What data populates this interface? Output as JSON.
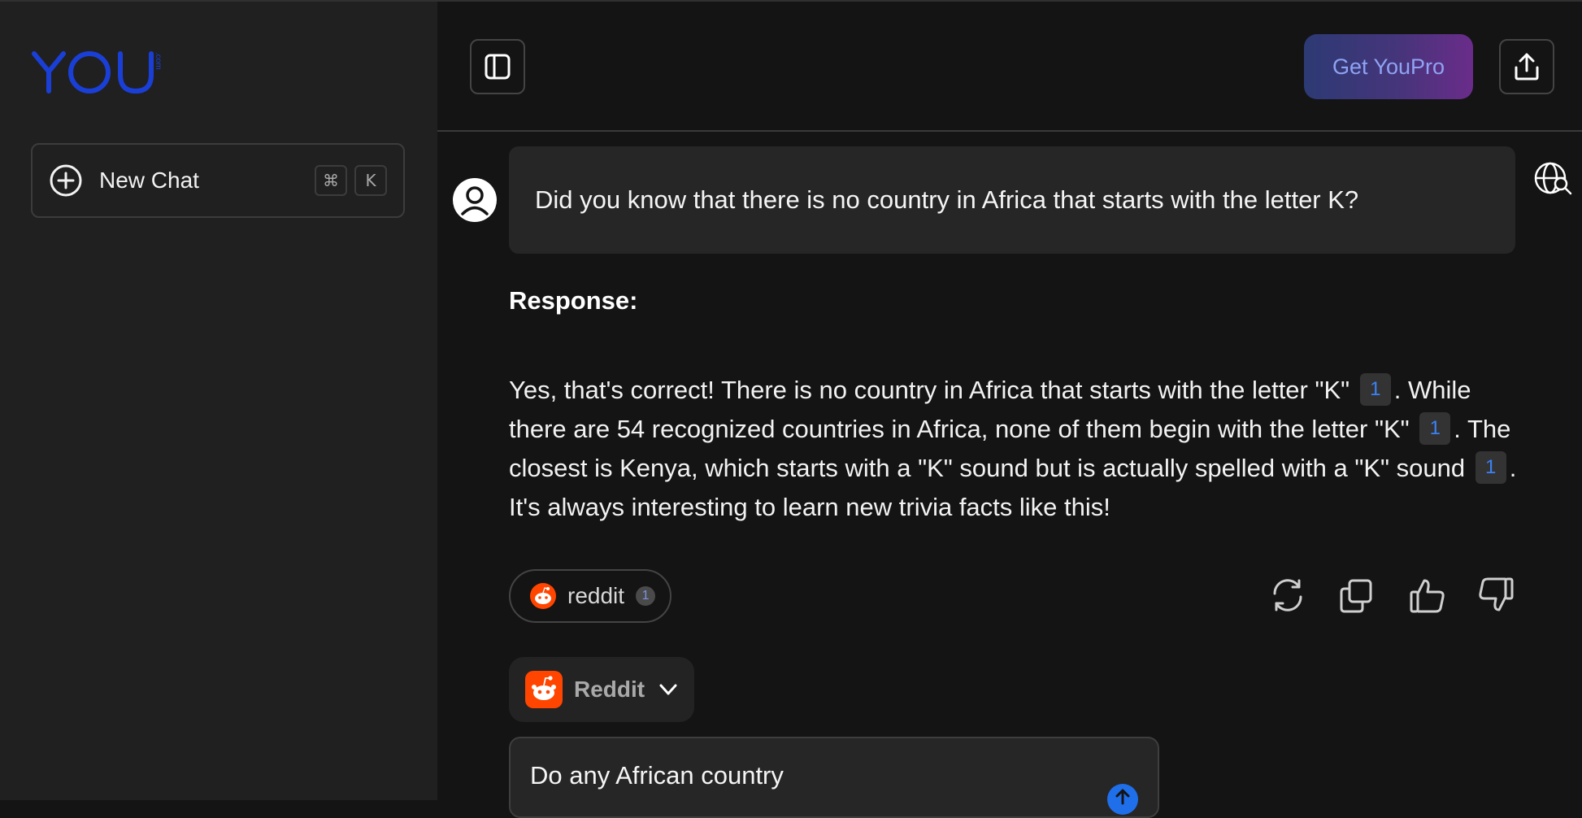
{
  "brand": {
    "logo_text": "YOU",
    "logo_suffix": ".com",
    "accent": "#1a3fd6"
  },
  "sidebar": {
    "new_chat_label": "New Chat",
    "shortcut_keys": [
      "⌘",
      "K"
    ]
  },
  "header": {
    "upgrade_label": "Get YouPro"
  },
  "conversation": {
    "question": "Did you know that there is no country in Africa that starts with the letter K?",
    "response_label": "Response:",
    "answer_parts": {
      "p1": "Yes, that's correct! There is no country in Africa that starts with the letter \"K\"",
      "c1": "1",
      "p2": ". While there are 54 recognized countries in Africa, none of them begin with the letter \"K\"",
      "c2": "1",
      "p3": ". The closest is Kenya, which starts with a \"K\" sound but is actually spelled with a \"K\" sound",
      "c3": "1",
      "p4": ". It's always interesting to learn new trivia facts like this!"
    },
    "source_chip": {
      "name": "reddit",
      "count": "1"
    },
    "actions": [
      "refresh-icon",
      "copy-icon",
      "thumbs-up-icon",
      "thumbs-down-icon"
    ],
    "source_card": {
      "name": "Reddit"
    },
    "preview_text": "Do any African country"
  },
  "colors": {
    "sidebar_bg": "#202020",
    "main_bg": "#141414",
    "citation_blue": "#3b82f6",
    "reddit_orange": "#ff4500"
  }
}
